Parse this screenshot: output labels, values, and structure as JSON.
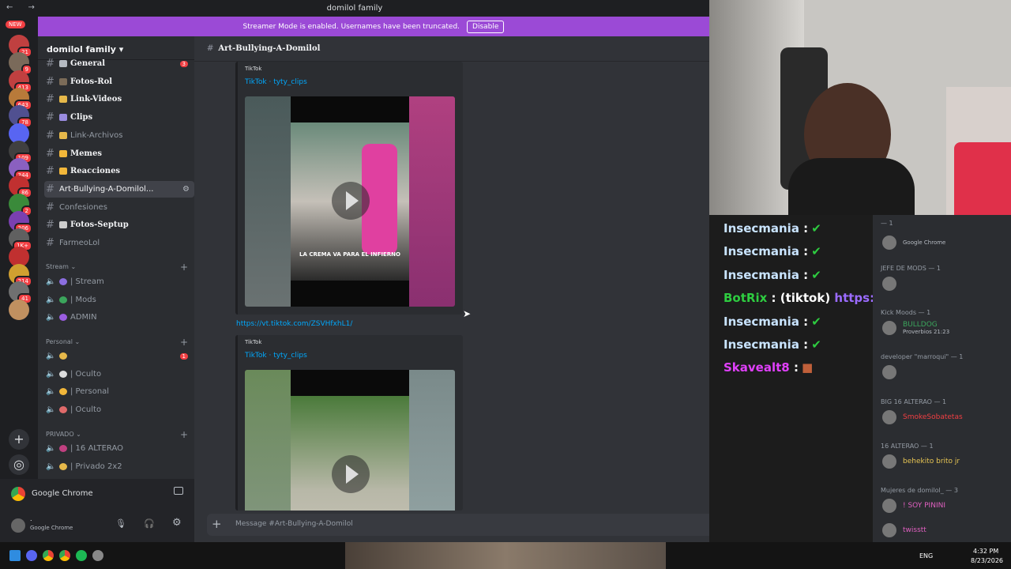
{
  "window": {
    "title": "domilol family",
    "nav": "← →"
  },
  "banner": {
    "text": "Streamer Mode is enabled. Usernames have been truncated.",
    "button": "Disable"
  },
  "rail": {
    "new_badge": "NEW",
    "badges": [
      "21",
      "9",
      "413",
      "643",
      "78",
      "",
      "109",
      "344",
      "86",
      "2",
      "206",
      "1K+",
      "",
      "214",
      "41",
      ""
    ]
  },
  "guild": {
    "name": "domilol family ▾"
  },
  "channels": [
    {
      "name": "General",
      "on": true,
      "badge": "3",
      "emoji_color": "#b5bac1"
    },
    {
      "name": "Fotos-Rol",
      "on": true,
      "emoji_color": "#7b6b58"
    },
    {
      "name": "Link-Videos",
      "on": true,
      "emoji_color": "#e6b84a"
    },
    {
      "name": "Clips",
      "on": true,
      "emoji_color": "#9a8ce0"
    },
    {
      "name": "Link-Archivos",
      "on": false,
      "emoji_color": "#e6b84a"
    },
    {
      "name": "Memes",
      "on": true,
      "emoji_color": "#f2b73a"
    },
    {
      "name": "Reacciones",
      "on": true,
      "emoji_color": "#f2b73a"
    },
    {
      "name": "Art-Bullying-A-Domilol...",
      "on": false,
      "selected": true,
      "emoji_color": ""
    },
    {
      "name": "Confesiones",
      "on": false,
      "emoji_color": ""
    },
    {
      "name": "Fotos-Septup",
      "on": true,
      "emoji_color": "#cccccc"
    },
    {
      "name": "FarmeoLol",
      "on": false,
      "emoji_color": ""
    }
  ],
  "categories": {
    "stream": "Stream",
    "personal": "Personal",
    "privado": "PRIVADO"
  },
  "voice": {
    "stream": [
      {
        "name": "| Stream",
        "c": "#8b6ee0"
      },
      {
        "name": "| Mods",
        "c": "#3ba55c"
      },
      {
        "name": "ADMIN",
        "c": "#9a5de0"
      }
    ],
    "personal": [
      {
        "name": "",
        "c": "#e6b84a",
        "badge": "1"
      },
      {
        "name": "| Oculto",
        "c": "#dddddd"
      },
      {
        "name": "| Personal",
        "c": "#f2b73a"
      },
      {
        "name": "| Oculto",
        "c": "#e06a6a"
      }
    ],
    "privado": [
      {
        "name": "| 16 ALTERAO",
        "c": "#c04080"
      },
      {
        "name": "| Privado 2x2",
        "c": "#e6b84a"
      }
    ]
  },
  "activity": {
    "label": "Google Chrome"
  },
  "user": {
    "name": ".",
    "status": "Google Chrome"
  },
  "channel_header": {
    "hash": "#",
    "name": "Art-Bullying-A-Domilol"
  },
  "embeds": [
    {
      "provider": "TikTok",
      "author": "TikTok · tyty_clips",
      "caption": "LA CREMA VA PARA EL INFIERNO"
    },
    {
      "provider": "TikTok",
      "author": "TikTok · tyty_clips",
      "caption": ""
    }
  ],
  "link": "https://vt.tiktok.com/ZSVHfxhL1/",
  "composer": {
    "placeholder": "Message #Art-Bullying-A-Domilol"
  },
  "overlay_chat": [
    {
      "user": "Insecmania",
      "sep": " :",
      "msg": "",
      "color": "#c9e4ff"
    },
    {
      "user": "Insecmania",
      "sep": " :",
      "msg": "",
      "color": "#c9e4ff"
    },
    {
      "user": "Insecmania",
      "sep": " :",
      "msg": "",
      "color": "#c9e4ff"
    },
    {
      "user": "BotRix",
      "sep": " : (tiktok) ",
      "msg": "https://www.tiktok.com/@dom",
      "color": "#2ecc40"
    },
    {
      "user": "Insecmania",
      "sep": " :",
      "msg": "",
      "color": "#c9e4ff"
    },
    {
      "user": "Insecmania",
      "sep": " :",
      "msg": "",
      "color": "#c9e4ff"
    },
    {
      "user": "Skavealt8",
      "sep": " :",
      "msg": "",
      "color": "#e040fb"
    }
  ],
  "members": {
    "top_role": "— 1",
    "top_member_status": "Google Chrome",
    "roles": [
      {
        "role": "JEFE DE MODS — 1",
        "member": "",
        "status": ""
      },
      {
        "role": "Kick Moods — 1",
        "member": "BULLDOG",
        "status": "Proverbios 21:23",
        "color": "#3ba55c"
      },
      {
        "role": "developer \"marroqui\" — 1",
        "member": "",
        "status": ""
      },
      {
        "role": "BIG 16 ALTERAO — 1",
        "member": "SmokeSobatetas",
        "status": "",
        "color": "#f23f43"
      },
      {
        "role": "16 ALTERAO — 1",
        "member": "behekito brito jr",
        "status": "",
        "color": "#e6c453"
      },
      {
        "role": "Mujeres de domilol_ — 3",
        "member": "! SOY PININI",
        "status": "",
        "color": "#e060c0"
      }
    ],
    "last_member": "twisstt"
  },
  "taskbar": {
    "lang": "ENG",
    "time": "4:32 PM",
    "date": "8/23/2026"
  }
}
